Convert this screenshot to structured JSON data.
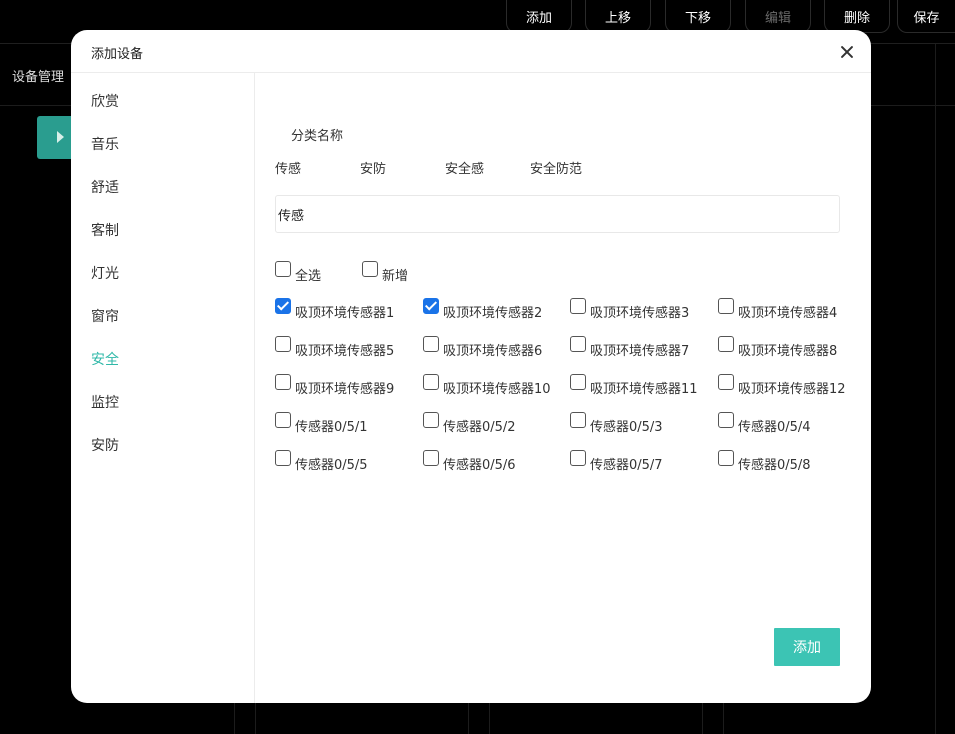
{
  "toolbar": {
    "add_label": "添加",
    "move_up_label": "上移",
    "move_down_label": "下移",
    "edit_label": "编辑",
    "delete_label": "删除",
    "save_label": "保存"
  },
  "background": {
    "section_title": "设备管理"
  },
  "modal": {
    "title": "添加设备",
    "sidebar": {
      "items": [
        {
          "label": "欣赏"
        },
        {
          "label": "音乐"
        },
        {
          "label": "舒适"
        },
        {
          "label": "客制"
        },
        {
          "label": "灯光"
        },
        {
          "label": "窗帘"
        },
        {
          "label": "安全",
          "active": true
        },
        {
          "label": "监控"
        },
        {
          "label": "安防"
        }
      ]
    },
    "category_label": "分类名称",
    "tags": [
      "传感",
      "安防",
      "安全感",
      "安全防范"
    ],
    "name_input_value": "传感",
    "select_all_label": "全选",
    "add_new_label": "新增",
    "devices": [
      {
        "label": "吸顶环境传感器1",
        "checked": true
      },
      {
        "label": "吸顶环境传感器2",
        "checked": true
      },
      {
        "label": "吸顶环境传感器3",
        "checked": false
      },
      {
        "label": "吸顶环境传感器4",
        "checked": false
      },
      {
        "label": "吸顶环境传感器5",
        "checked": false
      },
      {
        "label": "吸顶环境传感器6",
        "checked": false
      },
      {
        "label": "吸顶环境传感器7",
        "checked": false
      },
      {
        "label": "吸顶环境传感器8",
        "checked": false
      },
      {
        "label": "吸顶环境传感器9",
        "checked": false
      },
      {
        "label": "吸顶环境传感器10",
        "checked": false
      },
      {
        "label": "吸顶环境传感器11",
        "checked": false
      },
      {
        "label": "吸顶环境传感器12",
        "checked": false
      },
      {
        "label": "传感器0/5/1",
        "checked": false
      },
      {
        "label": "传感器0/5/2",
        "checked": false
      },
      {
        "label": "传感器0/5/3",
        "checked": false
      },
      {
        "label": "传感器0/5/4",
        "checked": false
      },
      {
        "label": "传感器0/5/5",
        "checked": false
      },
      {
        "label": "传感器0/5/6",
        "checked": false
      },
      {
        "label": "传感器0/5/7",
        "checked": false
      },
      {
        "label": "传感器0/5/8",
        "checked": false
      }
    ],
    "submit_label": "添加"
  },
  "colors": {
    "accent": "#3cc4b4",
    "active_nav": "#2fb8a8",
    "checkbox_checked": "#1a73e8",
    "background": "#000000"
  }
}
